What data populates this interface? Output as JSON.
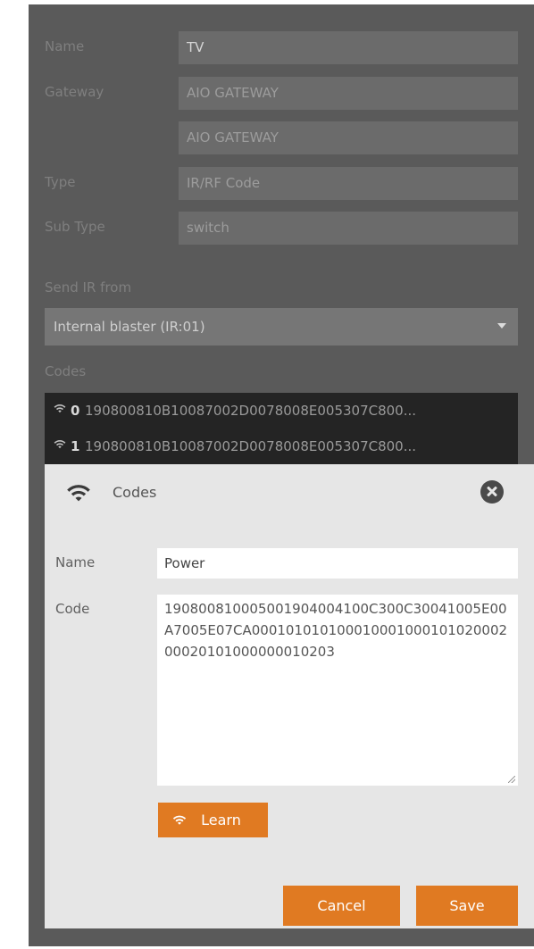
{
  "form": {
    "name": {
      "label": "Name",
      "value": "TV"
    },
    "gateway": {
      "label": "Gateway",
      "value": "AIO GATEWAY",
      "value2": "AIO GATEWAY"
    },
    "type": {
      "label": "Type",
      "value": "IR/RF Code"
    },
    "sub_type": {
      "label": "Sub Type",
      "value": "switch"
    },
    "send_ir": {
      "label": "Send IR from",
      "selected": "Internal blaster (IR:01)"
    },
    "codes": {
      "label": "Codes",
      "items": [
        {
          "index": "0",
          "code": "190800810B10087002D0078008E005307C800..."
        },
        {
          "index": "1",
          "code": "190800810B10087002D0078008E005307C800..."
        }
      ]
    }
  },
  "dialog": {
    "title": "Codes",
    "icon": "wifi-icon",
    "name_label": "Name",
    "name_value": "Power",
    "code_label": "Code",
    "code_value": "19080081000500190400410 0C300C30041005E00A7005E07CA00010101010001000100010102000200020101000000010203",
    "learn_label": "Learn",
    "cancel_label": "Cancel",
    "save_label": "Save"
  },
  "colors": {
    "panel": "#5a5a5a",
    "accent": "#e07a22",
    "dialog": "#e6e6e6"
  }
}
